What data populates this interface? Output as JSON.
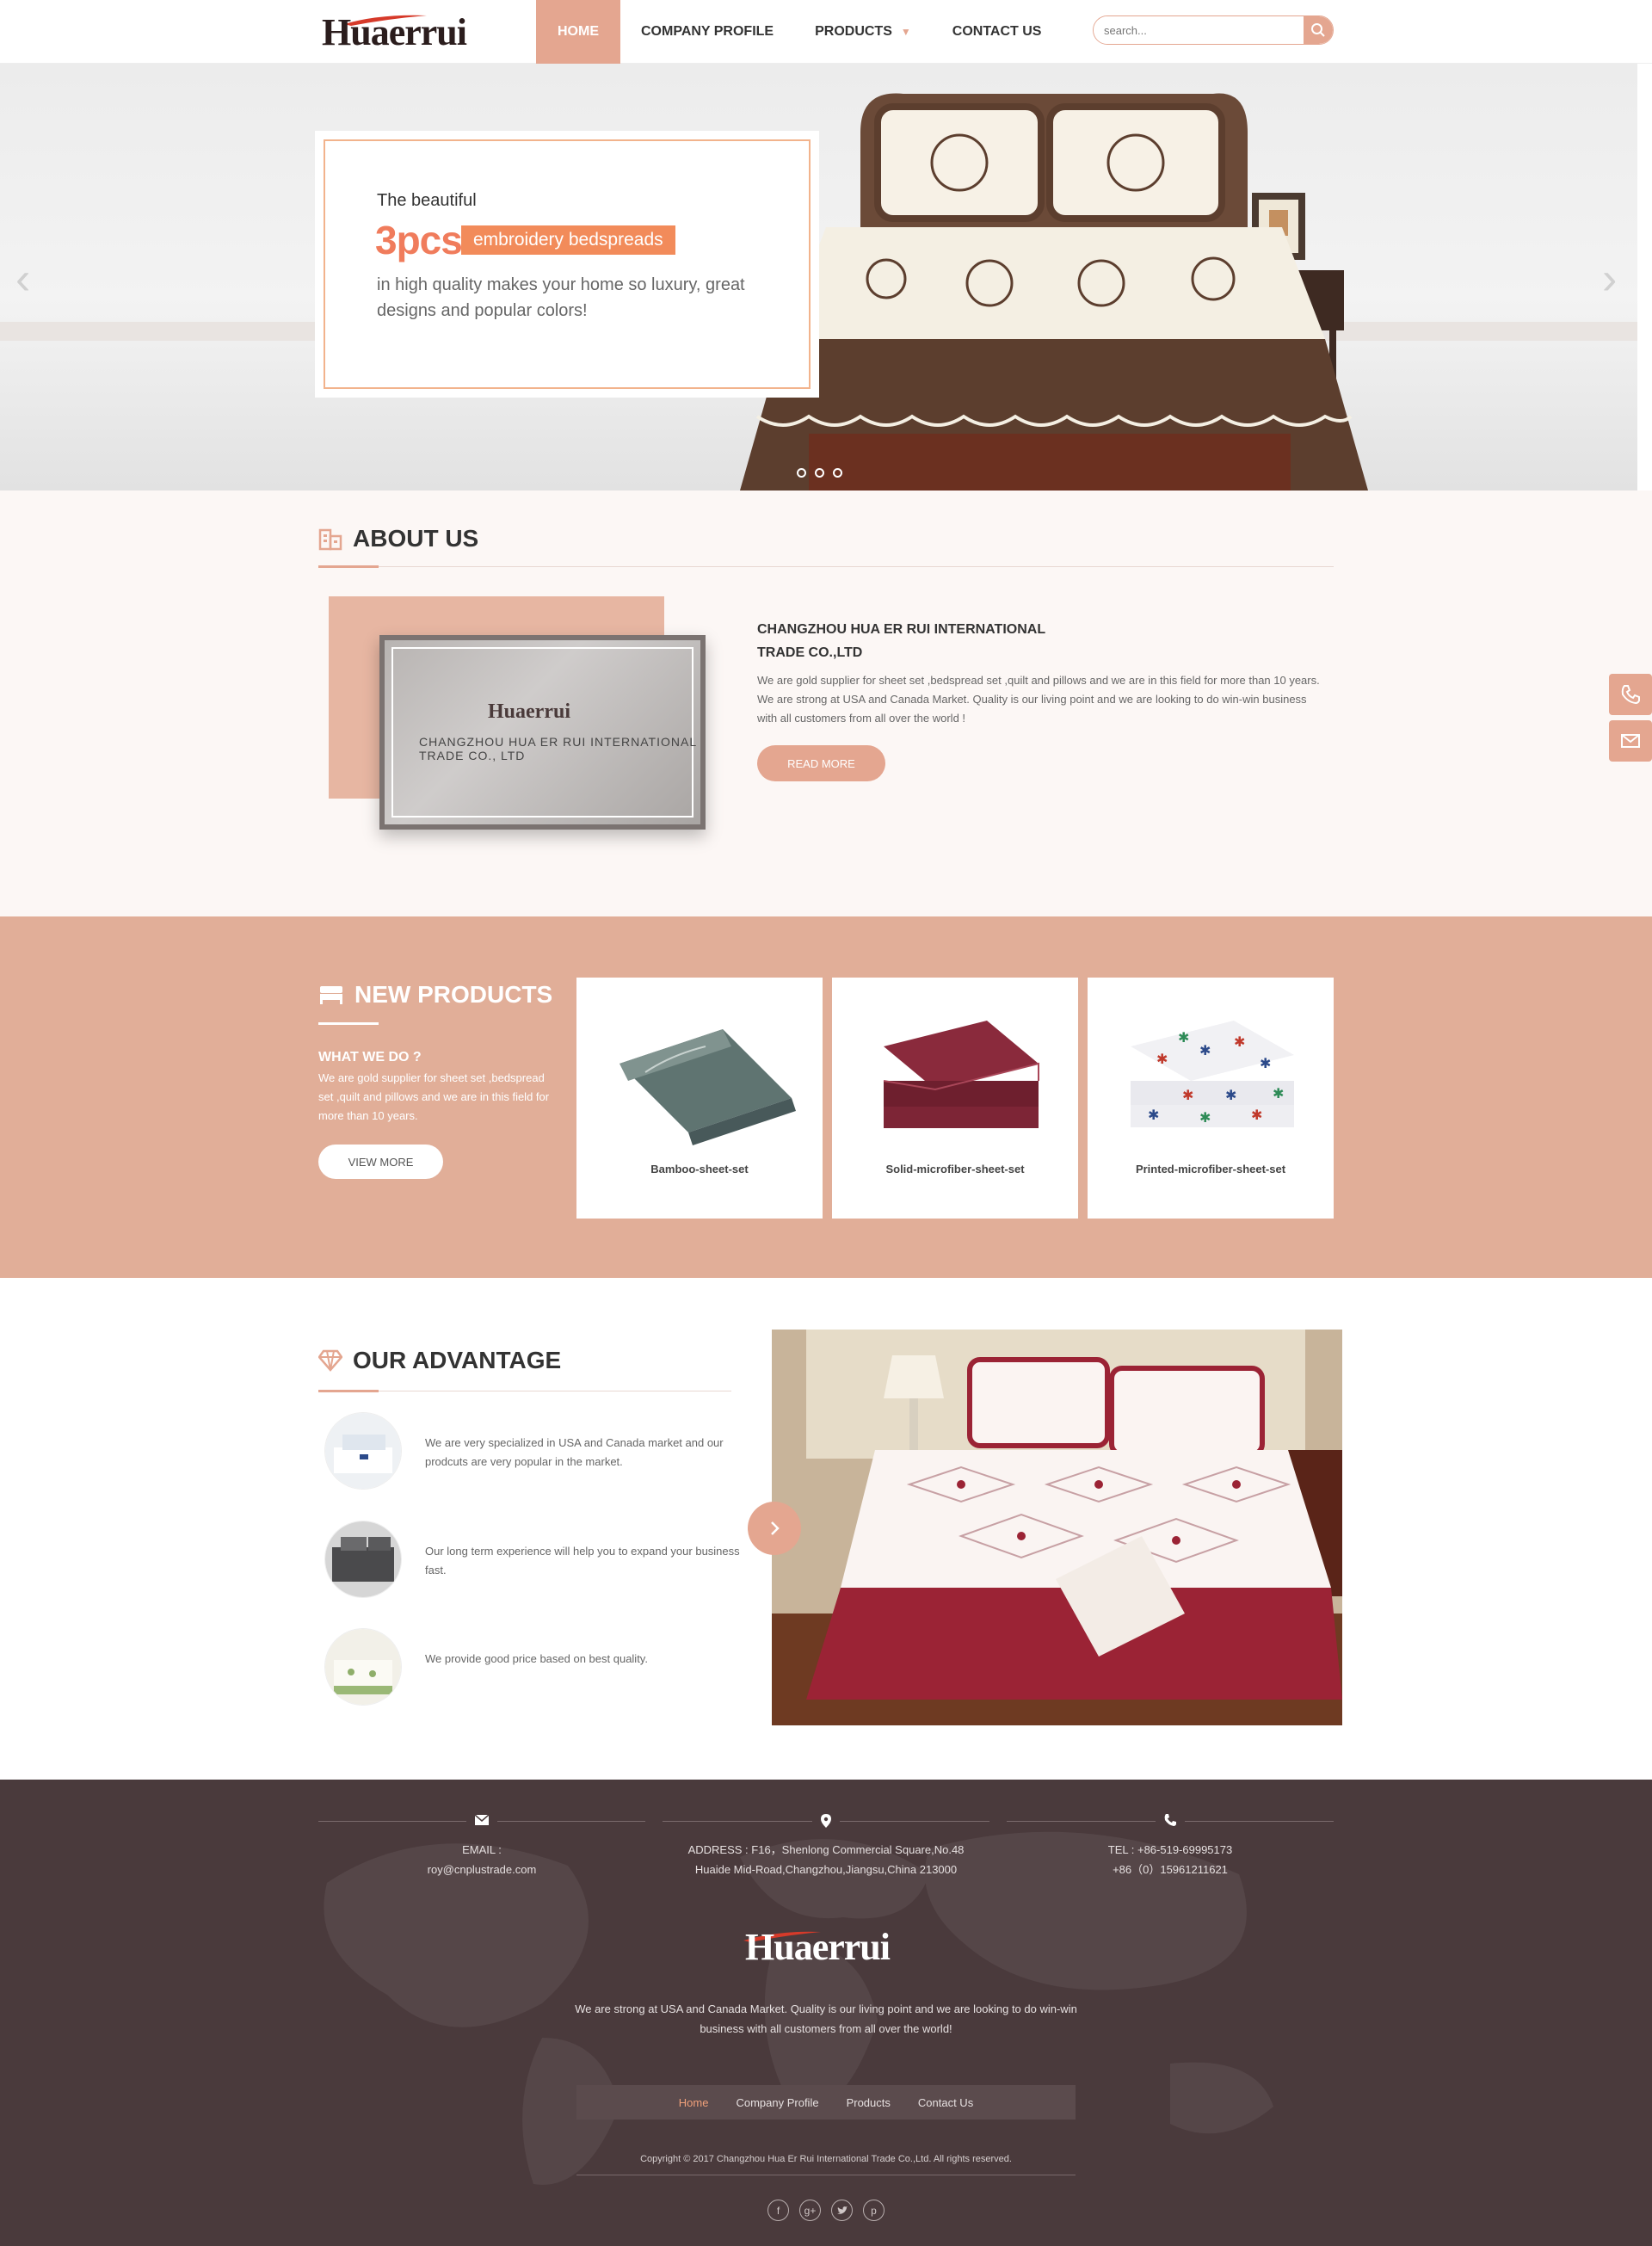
{
  "header": {
    "logo_text": "Huaerrui",
    "nav": [
      "HOME",
      "COMPANY PROFILE",
      "PRODUCTS",
      "CONTACT US"
    ],
    "search_placeholder": "search..."
  },
  "hero": {
    "line1": "The beautiful",
    "big": "3pcs",
    "tag": "embroidery bedspreads",
    "desc": "in high quality makes your home so luxury, great designs and popular colors!",
    "slides": 3
  },
  "about": {
    "title": "ABOUT US",
    "company": "CHANGZHOU HUA ER RUI INTERNATIONAL TRADE CO.,LTD",
    "text": "We are gold supplier for sheet set ,bedspread set ,quilt and pillows and we are in this field for more than 10 years. We are strong at USA and Canada Market. Quality is our living point and we are looking to do win-win business with all customers from all over the world !",
    "button": "READ MORE",
    "photo_sign": "Huaerrui",
    "photo_caption": "CHANGZHOU HUA ER RUI INTERNATIONAL TRADE CO., LTD"
  },
  "products": {
    "title": "NEW PRODUCTS",
    "subtitle": "WHAT WE DO ?",
    "desc": "We are gold supplier for sheet set ,bedspread set ,quilt and pillows and we are in this field for more than 10 years.",
    "button": "VIEW MORE",
    "items": [
      {
        "name": "Bamboo-sheet-set"
      },
      {
        "name": "Solid-microfiber-sheet-set"
      },
      {
        "name": "Printed-microfiber-sheet-set"
      }
    ]
  },
  "advantage": {
    "title": "OUR ADVANTAGE",
    "items": [
      {
        "text": "We are very specialized in USA and Canada market and our prodcuts are very popular in the market."
      },
      {
        "text": "Our long term experience will help you to expand your business fast."
      },
      {
        "text": "We provide good price based on best quality."
      }
    ]
  },
  "footer": {
    "email_label": "EMAIL :",
    "email": "roy@cnplustrade.com",
    "address_1": "ADDRESS : F16，Shenlong Commercial Square,No.48",
    "address_2": "Huaide Mid-Road,Changzhou,Jiangsu,China 213000",
    "tel_1": "TEL : +86-519-69995173",
    "tel_2": "+86（0）15961211621",
    "logo_text": "Huaerrui",
    "about": "We are strong at USA and Canada Market. Quality is our living point and we are looking to do win-win business with all customers from all over the world!",
    "nav": [
      "Home",
      "Company Profile",
      "Products",
      "Contact Us"
    ],
    "copyright": "Copyright © 2017 Changzhou Hua Er Rui International Trade Co.,Ltd. All rights reserved.",
    "social": [
      "facebook-icon",
      "google-plus-icon",
      "twitter-icon",
      "pinterest-icon"
    ]
  },
  "colors": {
    "accent": "#e4a690",
    "hero_orange": "#f28b5a",
    "products_bg": "#e1ae98",
    "footer_bg": "#4a3a3c"
  }
}
